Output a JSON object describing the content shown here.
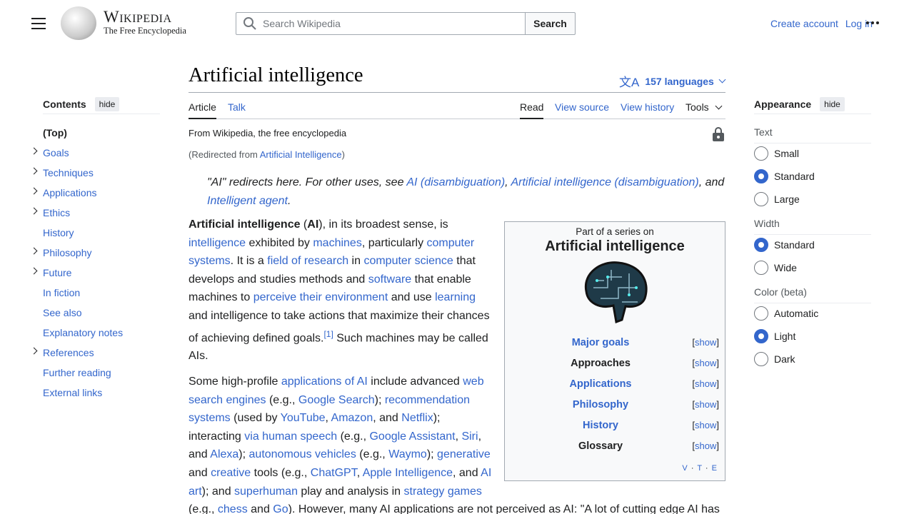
{
  "header": {
    "logo_title": "Wikipedia",
    "logo_tagline": "The Free Encyclopedia",
    "search_placeholder": "Search Wikipedia",
    "search_button": "Search",
    "create_account": "Create account",
    "log_in": "Log in"
  },
  "article": {
    "title": "Artificial intelligence",
    "languages": "157 languages",
    "tabs_left": [
      "Article",
      "Talk"
    ],
    "tabs_right": [
      "Read",
      "View source",
      "View history",
      "Tools"
    ],
    "from": "From Wikipedia, the free encyclopedia",
    "redirect_prefix": "(Redirected from ",
    "redirect_link": "Artificial Intelligence",
    "redirect_suffix": ")",
    "hatnote": [
      {
        "t": "\"AI\" redirects here. For other uses, see "
      },
      {
        "t": "AI (disambiguation)",
        "l": 1
      },
      {
        "t": ", "
      },
      {
        "t": "Artificial intelligence (disambiguation)",
        "l": 1
      },
      {
        "t": ", and "
      },
      {
        "t": "Intelligent agent",
        "l": 1
      },
      {
        "t": "."
      }
    ],
    "paragraphs": [
      [
        {
          "t": "Artificial intelligence",
          "b": 1
        },
        {
          "t": " ("
        },
        {
          "t": "AI",
          "b": 1
        },
        {
          "t": "), in its broadest sense, is"
        },
        {
          "br": 1
        },
        {
          "t": "intelligence",
          "l": 1
        },
        {
          "t": " exhibited by "
        },
        {
          "t": "machines",
          "l": 1
        },
        {
          "t": ", particularly "
        },
        {
          "t": "computer",
          "l": 1
        },
        {
          "br": 1
        },
        {
          "t": "systems",
          "l": 1
        },
        {
          "t": ". It is a "
        },
        {
          "t": "field of research",
          "l": 1
        },
        {
          "t": " in "
        },
        {
          "t": "computer science",
          "l": 1
        },
        {
          "t": " that"
        },
        {
          "br": 1
        },
        {
          "t": "develops and studies methods and "
        },
        {
          "t": "software",
          "l": 1
        },
        {
          "t": " that enable"
        },
        {
          "br": 1
        },
        {
          "t": "machines to "
        },
        {
          "t": "perceive their environment",
          "l": 1
        },
        {
          "t": " and use "
        },
        {
          "t": "learning",
          "l": 1
        },
        {
          "br": 1
        },
        {
          "t": "and intelligence to take actions that maximize their chances"
        },
        {
          "br": 1
        },
        {
          "t": "of achieving defined goals."
        },
        {
          "t": "[1]",
          "l": 1,
          "sup": 1
        },
        {
          "t": " Such machines may be called"
        },
        {
          "br": 1
        },
        {
          "t": "AIs."
        }
      ],
      [
        {
          "t": "Some high-profile "
        },
        {
          "t": "applications of AI",
          "l": 1
        },
        {
          "t": " include advanced "
        },
        {
          "t": "web",
          "l": 1
        },
        {
          "br": 1
        },
        {
          "t": "search engines",
          "l": 1
        },
        {
          "t": " (e.g., "
        },
        {
          "t": "Google Search",
          "l": 1
        },
        {
          "t": "); "
        },
        {
          "t": "recommendation",
          "l": 1
        },
        {
          "br": 1
        },
        {
          "t": "systems",
          "l": 1
        },
        {
          "t": " (used by "
        },
        {
          "t": "YouTube",
          "l": 1
        },
        {
          "t": ", "
        },
        {
          "t": "Amazon",
          "l": 1
        },
        {
          "t": ", and "
        },
        {
          "t": "Netflix",
          "l": 1
        },
        {
          "t": ");"
        },
        {
          "br": 1
        },
        {
          "t": "interacting "
        },
        {
          "t": "via human speech",
          "l": 1
        },
        {
          "t": " (e.g., "
        },
        {
          "t": "Google Assistant",
          "l": 1
        },
        {
          "t": ", "
        },
        {
          "t": "Siri",
          "l": 1
        },
        {
          "t": ","
        },
        {
          "br": 1
        },
        {
          "t": "and "
        },
        {
          "t": "Alexa",
          "l": 1
        },
        {
          "t": "); "
        },
        {
          "t": "autonomous vehicles",
          "l": 1
        },
        {
          "t": " (e.g., "
        },
        {
          "t": "Waymo",
          "l": 1
        },
        {
          "t": "); "
        },
        {
          "t": "generative",
          "l": 1
        },
        {
          "br": 1
        },
        {
          "t": "and "
        },
        {
          "t": "creative",
          "l": 1
        },
        {
          "t": " tools (e.g., "
        },
        {
          "t": "ChatGPT",
          "l": 1
        },
        {
          "t": ", "
        },
        {
          "t": "Apple Intelligence",
          "l": 1
        },
        {
          "t": ", and "
        },
        {
          "t": "AI",
          "l": 1
        },
        {
          "br": 1
        },
        {
          "t": "art",
          "l": 1
        },
        {
          "t": "); and "
        },
        {
          "t": "superhuman",
          "l": 1
        },
        {
          "t": " play and analysis in "
        },
        {
          "t": "strategy games",
          "l": 1
        },
        {
          "br": 1
        },
        {
          "t": "(e.g., "
        },
        {
          "t": "chess",
          "l": 1
        },
        {
          "t": " and "
        },
        {
          "t": "Go",
          "l": 1
        },
        {
          "t": "). However, many AI applications are not perceived as AI: \"A lot of cutting edge AI has"
        }
      ]
    ]
  },
  "infobox": {
    "series": "Part of a series on",
    "title": "Artificial intelligence",
    "rows": [
      {
        "label": "Major goals",
        "link": true
      },
      {
        "label": "Approaches",
        "link": false
      },
      {
        "label": "Applications",
        "link": true
      },
      {
        "label": "Philosophy",
        "link": true
      },
      {
        "label": "History",
        "link": true
      },
      {
        "label": "Glossary",
        "link": false
      }
    ],
    "show": "show",
    "vte": [
      "V",
      "T",
      "E"
    ]
  },
  "toc": {
    "title": "Contents",
    "hide": "hide",
    "items": [
      {
        "label": "(Top)",
        "exp": false
      },
      {
        "label": "Goals",
        "exp": true
      },
      {
        "label": "Techniques",
        "exp": true
      },
      {
        "label": "Applications",
        "exp": true
      },
      {
        "label": "Ethics",
        "exp": true
      },
      {
        "label": "History",
        "exp": false
      },
      {
        "label": "Philosophy",
        "exp": true
      },
      {
        "label": "Future",
        "exp": true
      },
      {
        "label": "In fiction",
        "exp": false
      },
      {
        "label": "See also",
        "exp": false
      },
      {
        "label": "Explanatory notes",
        "exp": false
      },
      {
        "label": "References",
        "exp": true
      },
      {
        "label": "Further reading",
        "exp": false
      },
      {
        "label": "External links",
        "exp": false
      }
    ]
  },
  "appearance": {
    "title": "Appearance",
    "hide": "hide",
    "sections": [
      {
        "name": "Text",
        "options": [
          "Small",
          "Standard",
          "Large"
        ],
        "selected": "Standard"
      },
      {
        "name": "Width",
        "options": [
          "Standard",
          "Wide"
        ],
        "selected": "Standard"
      },
      {
        "name": "Color (beta)",
        "options": [
          "Automatic",
          "Light",
          "Dark"
        ],
        "selected": "Light"
      }
    ]
  },
  "colors": {
    "link": "#3366cc",
    "accent": "#3366cc"
  }
}
